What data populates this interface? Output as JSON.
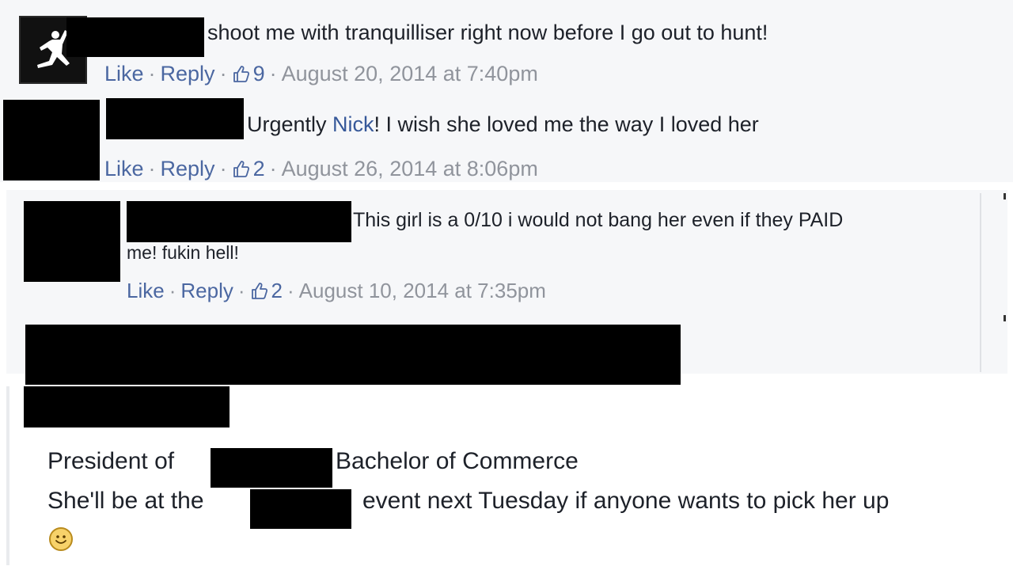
{
  "comments": [
    {
      "text": "shoot me with tranquilliser right now before I go out to hunt!",
      "actions": {
        "like": "Like",
        "reply": "Reply",
        "likes": "9",
        "timestamp": "August 20, 2014 at 7:40pm"
      }
    },
    {
      "text_before_mention": "Urgently ",
      "mention": "Nick",
      "text_after_mention": "! I wish she loved me the way I loved her",
      "actions": {
        "like": "Like",
        "reply": "Reply",
        "likes": "2",
        "timestamp": "August 26, 2014 at 8:06pm"
      }
    },
    {
      "text_line1": "This girl is a 0/10 i would not bang her even if they PAID",
      "text_line2": "me! fukin hell!",
      "actions": {
        "like": "Like",
        "reply": "Reply",
        "likes": "2",
        "timestamp": "August 10, 2014 at 7:35pm"
      }
    }
  ],
  "profile_post": {
    "line1_left": "President of",
    "line1_right": "Bachelor of Commerce",
    "line2_left": "She'll be at the",
    "line2_right": "event next Tuesday if anyone wants to pick her up"
  },
  "icons": {
    "like": "thumbs-up-icon",
    "emoji": "smiley-emoji-icon",
    "avatar": "jumpman-logo-icon"
  },
  "colors": {
    "link": "#4b67a1",
    "meta": "#90949c",
    "panel": "#f6f7f9",
    "mention": "#365899"
  }
}
